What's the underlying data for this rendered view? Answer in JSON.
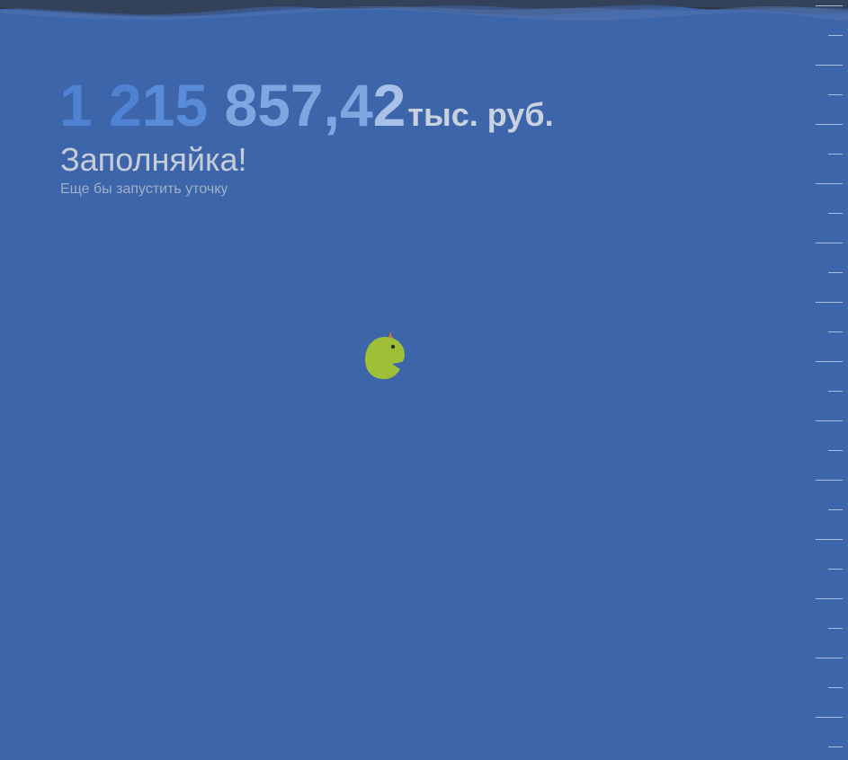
{
  "counter": {
    "amount_part1": "1 2",
    "amount_part2": "15",
    "amount_part3": " 857,4",
    "amount_part4": "2",
    "unit": "тыс. руб."
  },
  "status": {
    "title": "Заполняйка!",
    "caption": "Еще бы запустить уточку"
  },
  "icons": {
    "duck": "duck-icon",
    "waves": "wave-decoration",
    "ruler": "level-ruler"
  },
  "colors": {
    "background": "#3d65aa",
    "duck_body": "#9fc036",
    "duck_crest": "#c0763a",
    "wave_dark": "#2d3547"
  }
}
